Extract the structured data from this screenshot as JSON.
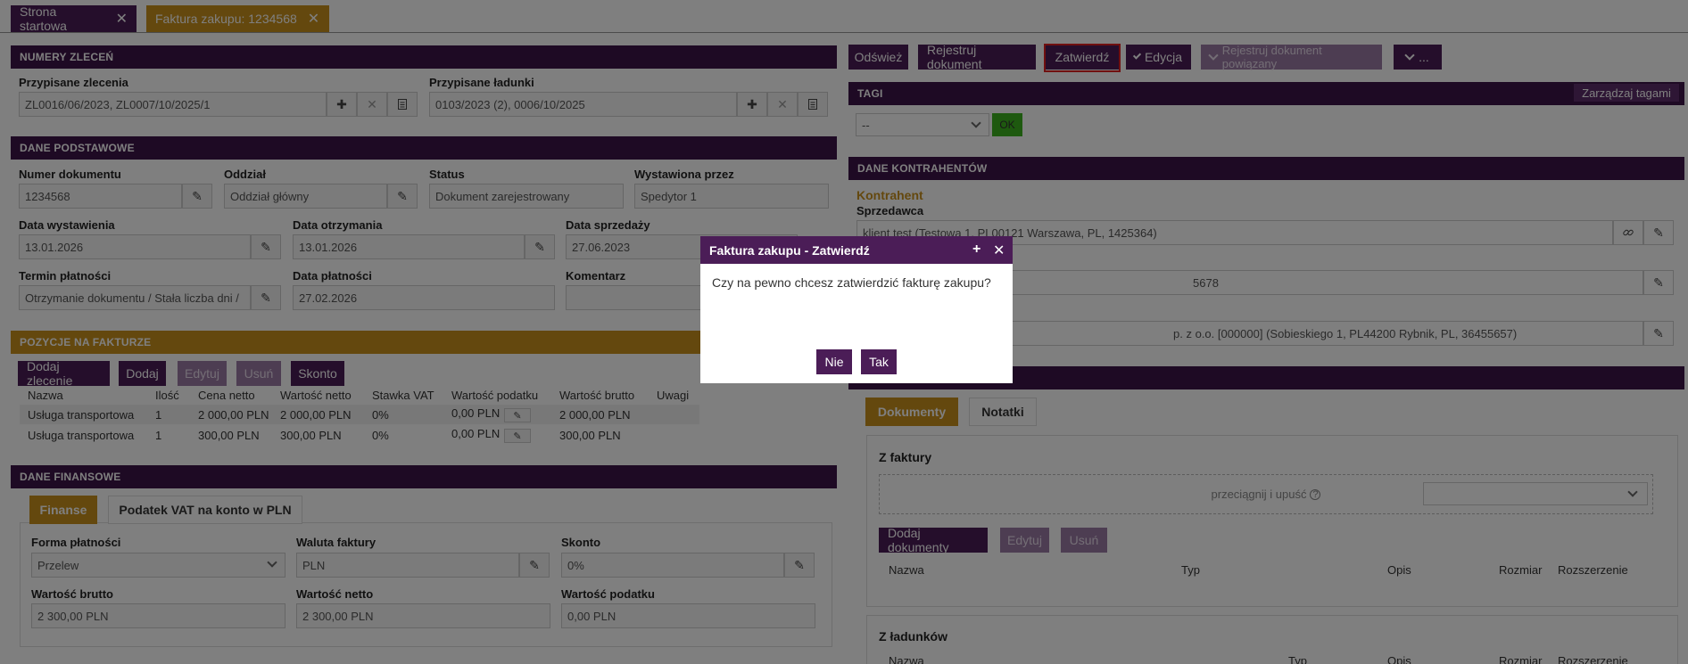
{
  "tabs": [
    {
      "label": "Strona startowa"
    },
    {
      "label": "Faktura zakupu: 1234568"
    }
  ],
  "numery": {
    "header": "NUMERY ZLECEŃ",
    "zlecenia_label": "Przypisane zlecenia",
    "zlecenia_value": "ZL0016/06/2023, ZL0007/10/2025/1",
    "ladunki_label": "Przypisane ładunki",
    "ladunki_value": "0103/2023 (2), 0006/10/2025"
  },
  "dane_podstawowe": {
    "header": "DANE PODSTAWOWE",
    "numer_label": "Numer dokumentu",
    "numer_value": "1234568",
    "oddzial_label": "Oddział",
    "oddzial_value": "Oddział główny",
    "status_label": "Status",
    "status_value": "Dokument zarejestrowany",
    "wystawiona_label": "Wystawiona przez",
    "wystawiona_value": "Spedytor 1",
    "data_wyst_label": "Data wystawienia",
    "data_wyst_value": "13.01.2026",
    "data_otrz_label": "Data otrzymania",
    "data_otrz_value": "13.01.2026",
    "data_sprz_label": "Data sprzedaży",
    "data_sprz_value": "27.06.2023",
    "termin_label": "Termin płatności",
    "termin_value": "Otrzymanie dokumentu / Stała liczba dni /",
    "data_plat_label": "Data płatności",
    "data_plat_value": "27.02.2026",
    "komentarz_label": "Komentarz"
  },
  "pozycje": {
    "header": "POZYCJE NA FAKTURZE",
    "buttons": [
      "Dodaj zlecenie",
      "Dodaj",
      "Edytuj",
      "Usuń",
      "Skonto"
    ],
    "columns": [
      "Nazwa",
      "Ilość",
      "Cena netto",
      "Wartość netto",
      "Stawka VAT",
      "Wartość podatku",
      "Wartość brutto",
      "Uwagi"
    ],
    "rows": [
      [
        "Usługa transportowa",
        "1",
        "2 000,00 PLN",
        "2 000,00 PLN",
        "0%",
        "0,00 PLN",
        "2 000,00 PLN",
        ""
      ],
      [
        "Usługa transportowa",
        "1",
        "300,00 PLN",
        "300,00 PLN",
        "0%",
        "0,00 PLN",
        "300,00 PLN",
        ""
      ]
    ]
  },
  "finanse": {
    "header": "DANE FINANSOWE",
    "tabs": [
      "Finanse",
      "Podatek VAT na konto w PLN"
    ],
    "forma_label": "Forma płatności",
    "forma_value": "Przelew",
    "waluta_label": "Waluta faktury",
    "waluta_value": "PLN",
    "skonto_label": "Skonto",
    "skonto_value": "0%",
    "brutto_label": "Wartość brutto",
    "brutto_value": "2 300,00 PLN",
    "netto_label": "Wartość netto",
    "netto_value": "2 300,00 PLN",
    "podatek_label": "Wartość podatku",
    "podatek_value": "0,00 PLN"
  },
  "toolbar": {
    "odswiez": "Odśwież",
    "rejestruj": "Rejestruj dokument",
    "zatwierdz": "Zatwierdź",
    "edycja": "Edycja",
    "rejestruj_powiazany": "Rejestruj dokument powiązany",
    "more": "..."
  },
  "tagi": {
    "header": "TAGI",
    "manage": "Zarządzaj tagami",
    "select_value": "--",
    "ok": "OK"
  },
  "kontrahenci": {
    "header": "DANE KONTRAHENTÓW",
    "kontrahent": "Kontrahent",
    "sprzedawca_label": "Sprzedawca",
    "sprzedawca_value": "klient test (Testowa 1, PL00121 Warszawa, PL, 1425364)",
    "field2_value": "5678",
    "field3_value": "p. z o.o. [000000] (Sobieskiego 1, PL44200 Rybnik, PL, 36455657)"
  },
  "dokumenty": {
    "tabs": [
      "Dokumenty",
      "Notatki"
    ],
    "z_faktury": "Z faktury",
    "dropzone": "przeciągnij i upuść",
    "buttons": [
      "Dodaj dokumenty",
      "Edytuj",
      "Usuń"
    ],
    "columns": [
      "Nazwa",
      "Typ",
      "Opis",
      "Rozmiar",
      "Rozszerzenie"
    ],
    "z_ladunkow": "Z ładunków"
  },
  "dialog": {
    "title": "Faktura zakupu - Zatwierdź",
    "message": "Czy na pewno chcesz zatwierdzić fakturę zakupu?",
    "no": "Nie",
    "yes": "Tak"
  }
}
